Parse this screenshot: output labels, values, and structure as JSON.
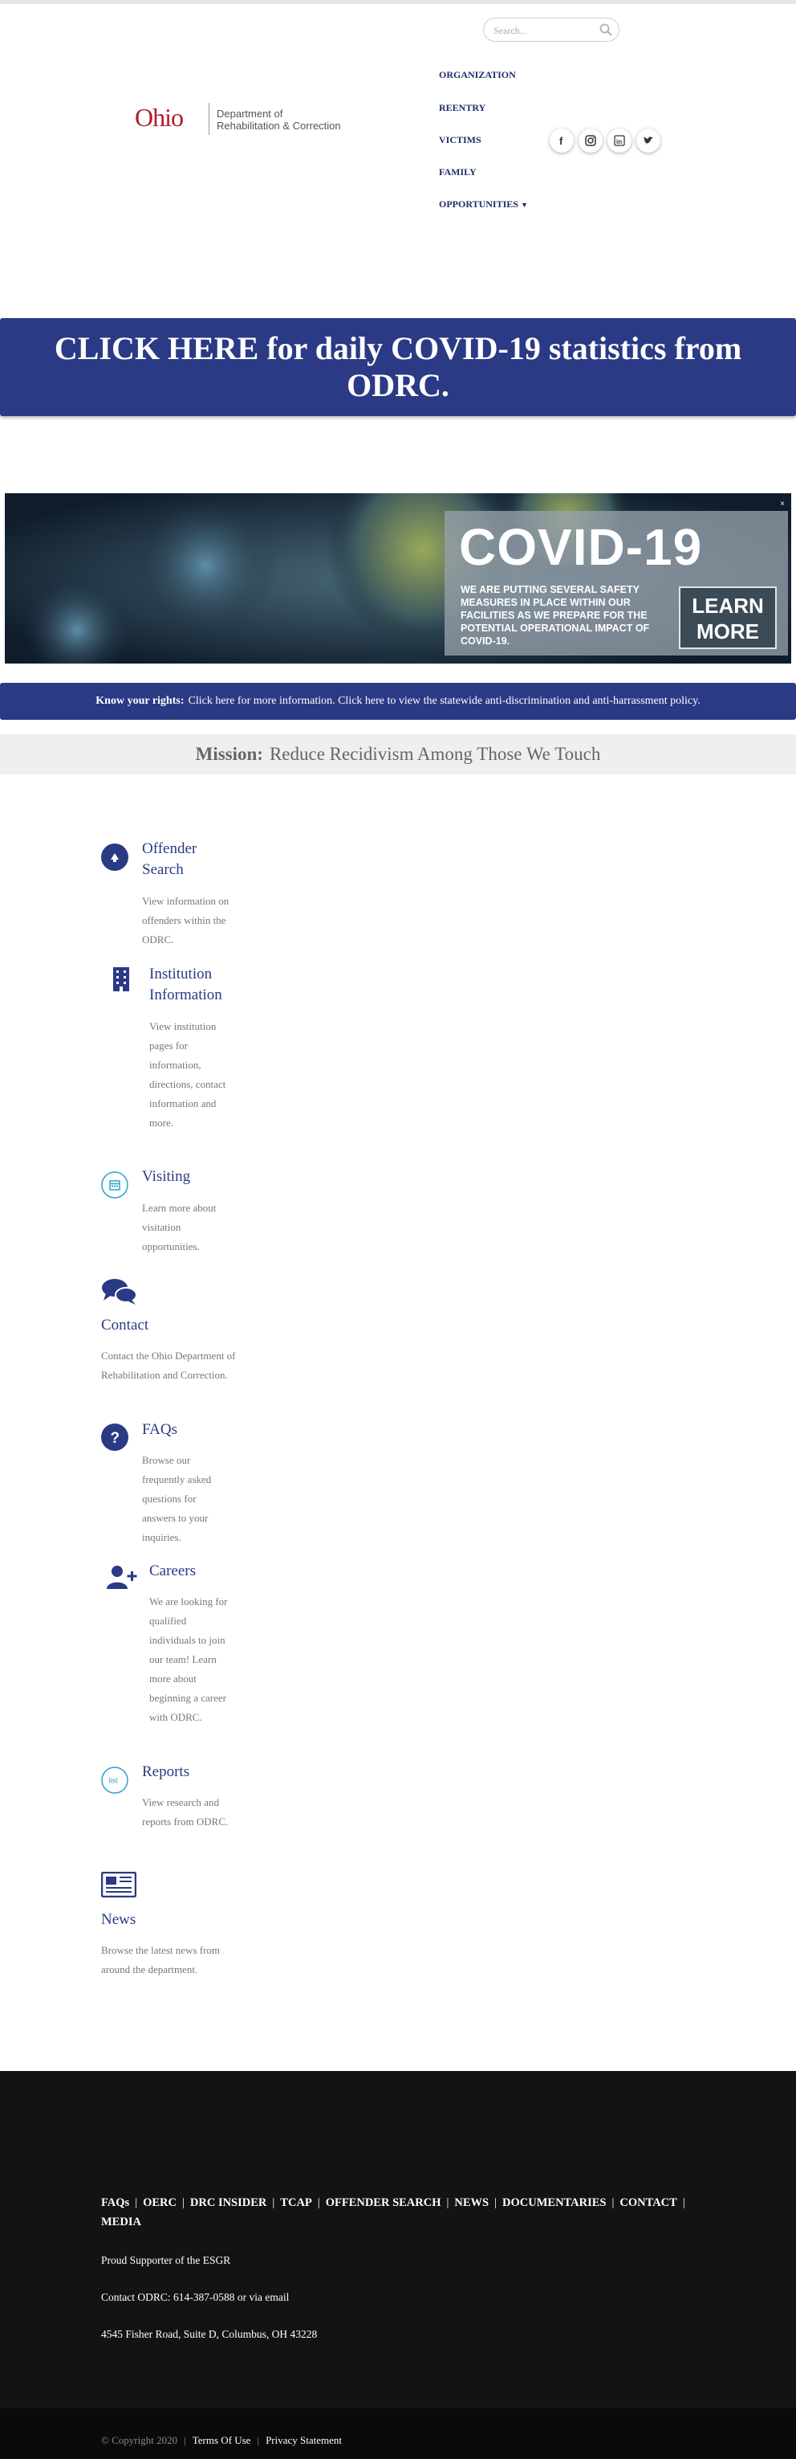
{
  "search": {
    "placeholder": "Search..."
  },
  "logo": {
    "ohio": "Ohio",
    "dept_line1": "Department of",
    "dept_line2": "Rehabilitation & Correction"
  },
  "nav": {
    "items": [
      "ORGANIZATION",
      "REENTRY",
      "VICTIMS",
      "FAMILY",
      "OPPORTUNITIES"
    ]
  },
  "social": {
    "icons": [
      "facebook-icon",
      "instagram-icon",
      "linkedin-icon",
      "twitter-icon"
    ]
  },
  "covid_banner": {
    "text": "CLICK HERE for daily COVID-19 statistics from ODRC."
  },
  "hero": {
    "headline": "COVID-19",
    "subtext": "WE ARE PUTTING SEVERAL SAFETY MEASURES IN PLACE WITHIN OUR FACILITIES AS WE PREPARE FOR THE POTENTIAL OPERATIONAL IMPACT OF COVID-19.",
    "button_line1": "LEARN",
    "button_line2": "MORE",
    "close": "×"
  },
  "rights": {
    "label": "Know your rights:",
    "text": "Click here for more information. Click here to view the statewide anti-discrimination and anti-harrassment policy."
  },
  "mission": {
    "label": "Mission:",
    "text": "Reduce Recidivism Among Those We Touch"
  },
  "services": [
    {
      "title": "Offender Search",
      "desc": "View information on offenders within the ODRC.",
      "icon": "offender-search-icon"
    },
    {
      "title": "Institution Information",
      "desc": "View institution pages for information, directions, contact information and more.",
      "icon": "building-icon"
    },
    {
      "title": "Visiting",
      "desc": "Learn more about visitation opportunities.",
      "icon": "calendar-icon"
    },
    {
      "title": "Contact",
      "desc": "Contact the Ohio Department of Rehabilitation and Correction.",
      "icon": "chat-icon"
    },
    {
      "title": "FAQs",
      "desc": "Browse our frequently asked questions for answers to your inquiries.",
      "icon": "question-icon"
    },
    {
      "title": "Careers",
      "desc": "We are looking for qualified individuals to join our team! Learn more about beginning a career with ODRC.",
      "icon": "add-user-icon"
    },
    {
      "title": "Reports",
      "desc": "View research and reports from ODRC.",
      "icon": "list-icon"
    },
    {
      "title": "News",
      "desc": "Browse the latest news from around the department.",
      "icon": "newspaper-icon"
    }
  ],
  "footer": {
    "links": [
      "FAQs",
      "OERC",
      "DRC INSIDER",
      "TCAP",
      "OFFENDER SEARCH",
      "NEWS",
      "DOCUMENTARIES",
      "CONTACT",
      "MEDIA"
    ],
    "esgr": "Proud Supporter of the ESGR",
    "contact": "Contact ODRC: 614-387-0588 or via email",
    "address": "4545 Fisher Road, Suite D, Columbus, OH 43228",
    "copyright": "© Copyright 2020",
    "terms": "Terms Of Use",
    "privacy": "Privacy Statement"
  },
  "colors": {
    "navy": "#2b3a84",
    "ohio_red": "#b01c2e",
    "footer_bg": "#131313"
  }
}
